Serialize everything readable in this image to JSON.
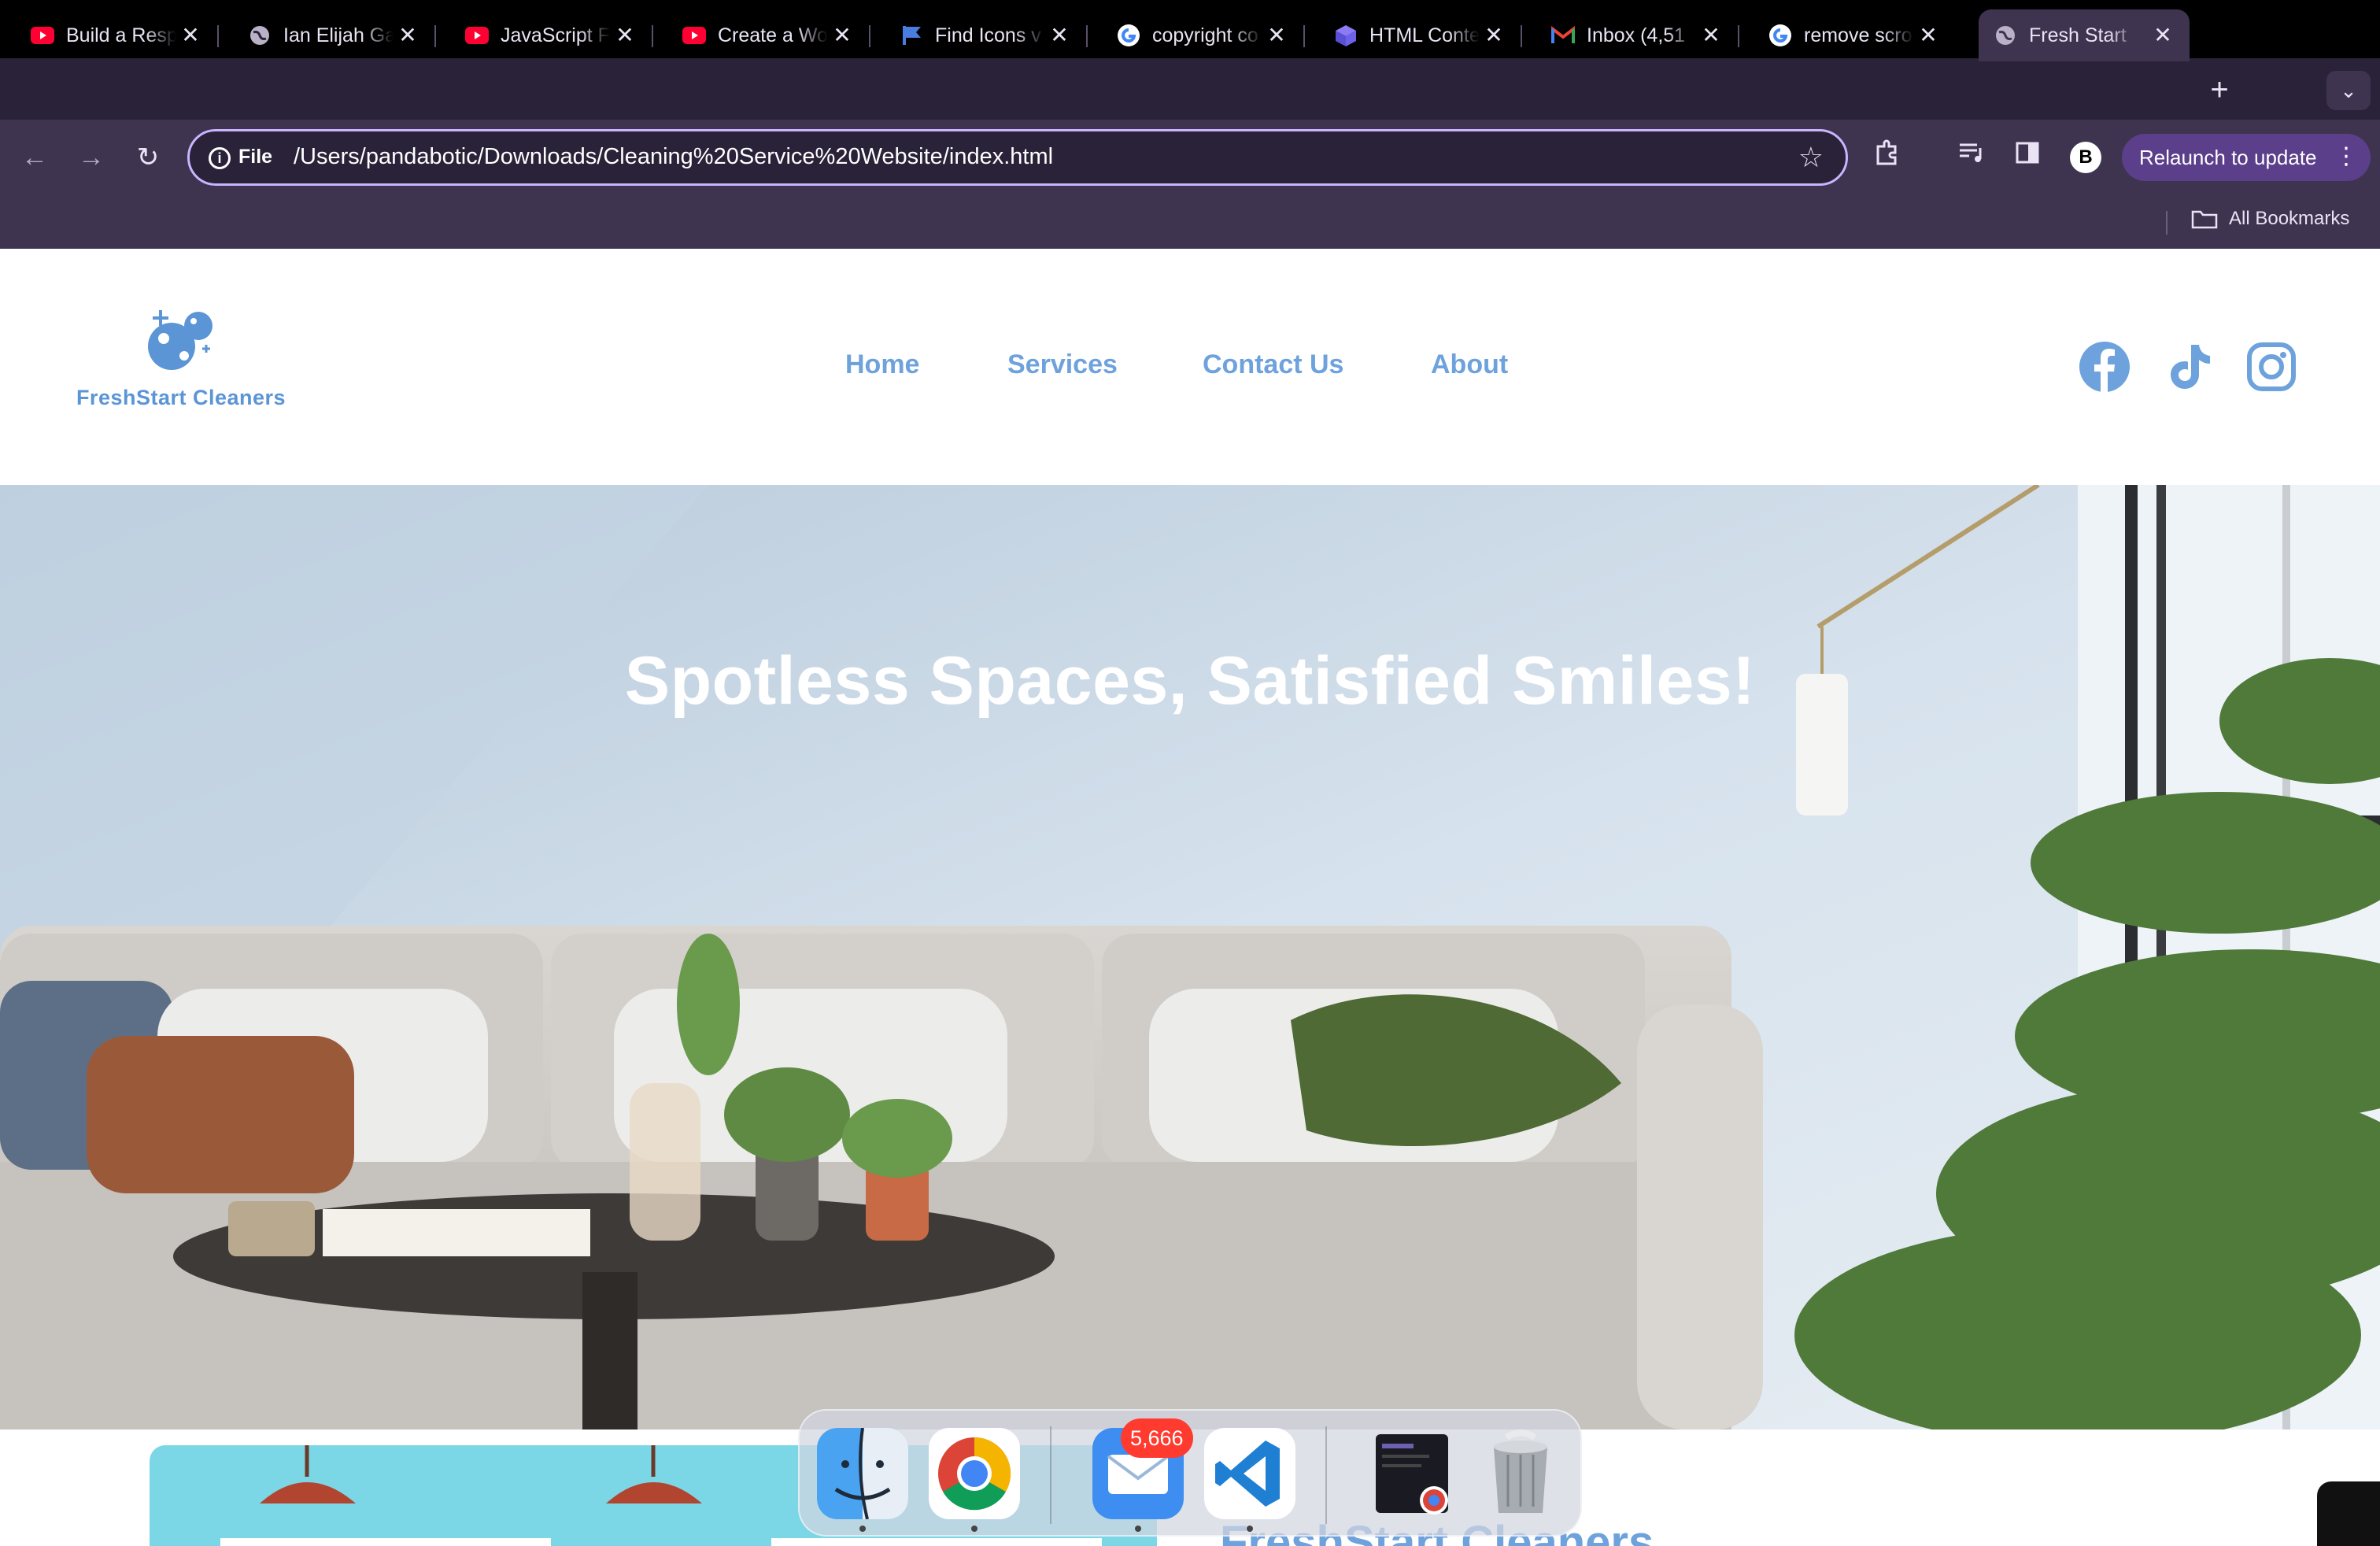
{
  "browser": {
    "tabs": [
      {
        "title": "Build a Resp",
        "icon": "youtube-icon"
      },
      {
        "title": "Ian Elijah Ga",
        "icon": "globe-icon"
      },
      {
        "title": "JavaScript F",
        "icon": "youtube-icon"
      },
      {
        "title": "Create a Wo",
        "icon": "youtube-icon"
      },
      {
        "title": "Find Icons v",
        "icon": "flag-icon"
      },
      {
        "title": "copyright co",
        "icon": "google-icon"
      },
      {
        "title": "HTML Conte",
        "icon": "cube-icon"
      },
      {
        "title": "Inbox (4,51",
        "icon": "gmail-icon"
      },
      {
        "title": "remove scro",
        "icon": "google-icon"
      },
      {
        "title": "Fresh Start",
        "icon": "globe-icon",
        "active": true
      }
    ],
    "address": {
      "scheme_label": "File",
      "url": "/Users/pandabotic/Downloads/Cleaning%20Service%20Website/index.html"
    },
    "relaunch_label": "Relaunch to update",
    "profile_initial": "B",
    "bookmarks": {
      "all_label": "All Bookmarks"
    }
  },
  "site": {
    "logo_text": "FreshStart Cleaners",
    "nav": [
      "Home",
      "Services",
      "Contact Us",
      "About"
    ],
    "social": [
      "facebook-icon",
      "tiktok-icon",
      "instagram-icon"
    ],
    "hero_title": "Spotless Spaces, Satisfied Smiles!",
    "section_heading": "FreshStart Cleaners",
    "colors": {
      "brand_blue": "#6ea2dc",
      "card_cyan": "#7bd7e6"
    }
  },
  "dock": {
    "apps": [
      "finder-icon",
      "chrome-icon",
      "mail-icon",
      "vscode-icon",
      "terminal-window-icon",
      "trash-icon"
    ],
    "mail_badge": "5,666"
  }
}
